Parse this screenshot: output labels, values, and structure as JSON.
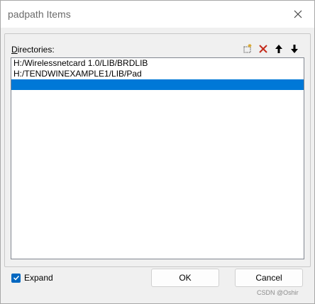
{
  "window": {
    "title": "padpath Items",
    "close_icon": "close-icon"
  },
  "directories": {
    "label_accel": "D",
    "label_rest": "irectories:",
    "toolbar": [
      {
        "name": "new-folder-icon",
        "color": "#d7a52a"
      },
      {
        "name": "delete-icon",
        "color": "#c42b1c"
      },
      {
        "name": "move-up-icon",
        "color": "#000000"
      },
      {
        "name": "move-down-icon",
        "color": "#000000"
      }
    ],
    "items": [
      "H:/Wirelessnetcard 1.0/LIB/BRDLIB",
      "H:/TENDWINEXAMPLE1/LIB/Pad",
      ""
    ],
    "selected_index": 2
  },
  "expand": {
    "label": "Expand",
    "checked": true
  },
  "buttons": {
    "ok": "OK",
    "cancel": "Cancel"
  },
  "watermark": "CSDN @Oshir",
  "colors": {
    "selection": "#0078d7",
    "checkbox": "#0067c0"
  }
}
